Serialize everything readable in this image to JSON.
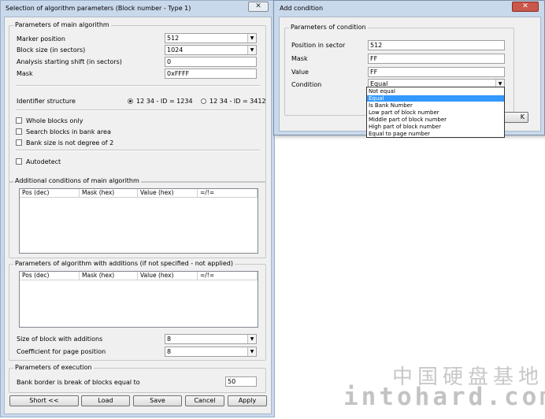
{
  "main": {
    "title": "Selection of algorithm parameters (Block number - Type 1)",
    "close": "✕",
    "params_group": "Parameters of main algorithm",
    "marker_label": "Marker position",
    "marker_value": "512",
    "blocksize_label": "Block size (in sectors)",
    "blocksize_value": "1024",
    "shift_label": "Analysis starting shift (in sectors)",
    "shift_value": "0",
    "mask_label": "Mask",
    "mask_value": "0xFFFF",
    "identifier_label": "Identifier structure",
    "radio1": "12 34 - ID = 1234",
    "radio2": "12 34 - ID = 3412",
    "chk_whole": "Whole blocks only",
    "chk_search": "Search blocks in bank area",
    "chk_bank": "Bank size is not degree of 2",
    "chk_auto": "Autodetect",
    "addcond_group": "Additional conditions of main algorithm",
    "columns": [
      "Pos (dec)",
      "Mask (hex)",
      "Value (hex)",
      "=/!="
    ],
    "additions_group": "Parameters of algorithm with additions (if not specified - not applied)",
    "size_label": "Size of block with additions",
    "size_value": "8",
    "coef_label": "Coefficient for page position",
    "coef_value": "8",
    "exec_group": "Parameters of execution",
    "bank_label": "Bank border is break of blocks equal to",
    "bank_value": "50",
    "buttons": {
      "short": "Short <<",
      "load": "Load",
      "save": "Save",
      "cancel": "Cancel",
      "apply": "Apply"
    }
  },
  "add": {
    "title": "Add condition",
    "close": "✕",
    "group": "Parameters of condition",
    "pos_label": "Position in sector",
    "pos_value": "512",
    "mask_label": "Mask",
    "mask_value": "FF",
    "value_label": "Value",
    "value_value": "FF",
    "cond_label": "Condition",
    "cond_value": "Equal",
    "ok_partial": "K",
    "options": [
      "Not equal",
      "Equal",
      "Is Bank Number",
      "Low part of block number",
      "Middle part of block number",
      "High part of block number",
      "Equal to page number"
    ],
    "selected_option": "Equal"
  },
  "watermark": {
    "cn": "中国硬盘基地",
    "en": "intohard.com"
  }
}
